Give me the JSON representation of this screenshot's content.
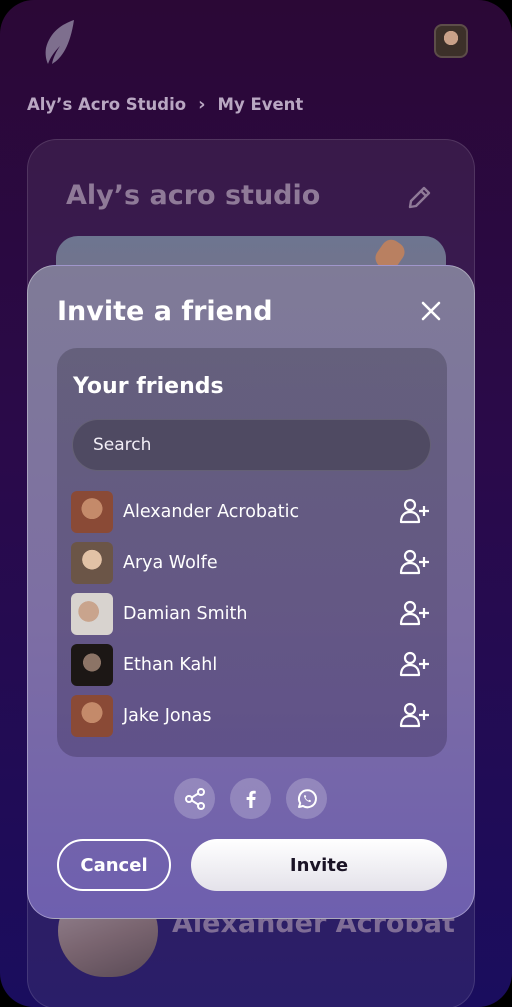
{
  "breadcrumb": {
    "studio": "Aly’s Acro Studio",
    "separator": "›",
    "event": "My Event"
  },
  "studio_card": {
    "title": "Aly’s acro studio",
    "participant_name": "Alexander Acrobat"
  },
  "modal": {
    "title": "Invite a friend",
    "friends_heading": "Your friends",
    "search_placeholder": "Search",
    "friends": [
      {
        "name": "Alexander Acrobatic",
        "avatar_color": "#a86a4f"
      },
      {
        "name": "Arya Wolfe",
        "avatar_color": "#c9a68b"
      },
      {
        "name": "Damian Smith",
        "avatar_color": "#b9a698"
      },
      {
        "name": "Ethan Kahl",
        "avatar_color": "#3b302c"
      },
      {
        "name": "Jake Jonas",
        "avatar_color": "#a86a4f"
      }
    ],
    "share_icons": [
      "share-icon",
      "facebook-icon",
      "whatsapp-icon"
    ],
    "cancel_label": "Cancel",
    "invite_label": "Invite"
  },
  "colors": {
    "background_top": "#2b0836",
    "background_bottom": "#1a0d5e",
    "modal_accent": "#7d6ea4"
  }
}
